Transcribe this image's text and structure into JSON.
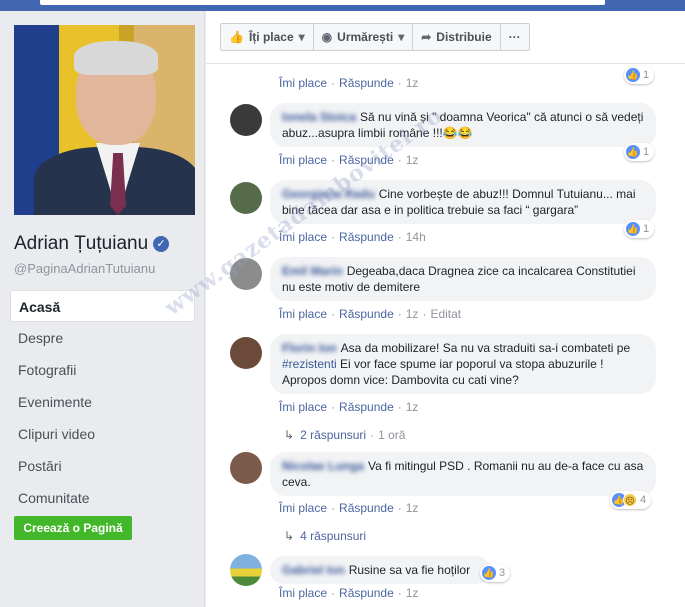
{
  "page": {
    "name": "Adrian Țuțuianu",
    "handle": "@PaginaAdrianTutuianu"
  },
  "nav": {
    "items": [
      {
        "label": "Acasă"
      },
      {
        "label": "Despre"
      },
      {
        "label": "Fotografii"
      },
      {
        "label": "Evenimente"
      },
      {
        "label": "Clipuri video"
      },
      {
        "label": "Postări"
      },
      {
        "label": "Comunitate"
      }
    ],
    "create_label": "Creează o Pagină"
  },
  "toolbar": {
    "like_label": "Îți place",
    "follow_label": "Urmărești",
    "share_label": "Distribuie",
    "more_label": "···"
  },
  "labels": {
    "like": "Îmi place",
    "reply": "Răspunde",
    "edited": "Editat"
  },
  "comments": [
    {
      "time": "1z",
      "reactions": "1"
    },
    {
      "author": "Ionela Stoica",
      "text": "Să nu vină și \" doamna Veorica\" că atunci o să vedeți abuz...asupra limbii române !!!😂😂",
      "time": "1z",
      "reactions": "1"
    },
    {
      "author": "Georgiana Radu",
      "text": "Cine vorbește de abuz!!! Domnul Tutuianu... mai bine tăcea dar asa e in politica trebuie sa faci “ gargara”",
      "time": "14h",
      "reactions": "1"
    },
    {
      "author": "Emil Marin",
      "text": "Degeaba,daca Dragnea zice ca incalcarea Constitutiei nu este motiv de demitere",
      "time": "1z"
    },
    {
      "author": "Florin Ion",
      "text": "Asa da mobilizare! Sa nu va straduiti sa-i combateti pe ",
      "hashtag": "#rezistenti",
      "text2": " Ei vor face spume iar poporul va stopa abuzurile ! Apropos domn vice: Dambovita cu cati vine?",
      "time": "1z",
      "replies": "2 răspunsuri",
      "replies_time": "1 oră"
    },
    {
      "author": "Nicolae Lunga",
      "text": "Va fi mitingul PSD . Romanii nu au de-a face cu asa ceva.",
      "time": "1z",
      "reactions": "4",
      "replies": "4 răspunsuri"
    },
    {
      "author": "Gabriel Ion",
      "text": "Rusine sa va fie hoților",
      "time": "1z",
      "reactions": "3"
    }
  ],
  "watermark": "www.gazetadambovitei.ro",
  "colors": {
    "brand": "#4267b2",
    "link": "#385898",
    "create_button": "#42b72a"
  }
}
